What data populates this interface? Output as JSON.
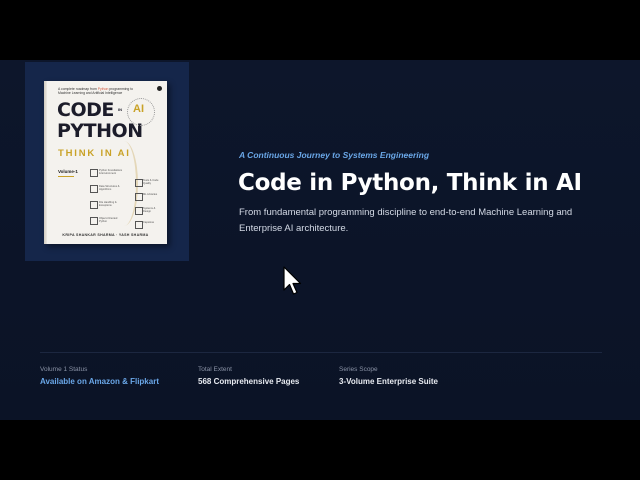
{
  "book_cover": {
    "tagline_prefix": "A complete roadmap from",
    "tagline_highlight": "Python",
    "tagline_rest": "programming to Machine Learning and Artificial Intelligence",
    "title_line1": "CODE",
    "title_in": "IN",
    "title_line2": "PYTHON",
    "ai_badge": "AI",
    "subtitle": "THINK IN AI",
    "volume": "Volume-1",
    "authors": "KRIPA SHANKAR SHARMA · YASH SHARMA",
    "icon_labels": [
      "Python Foundations & Environment",
      "Data Structures & Algorithms",
      "File Handling & Exceptions",
      "Object-Oriented Python",
      "Tests & Code Quality",
      "ML Libraries",
      "Systems & Design",
      "Capstone"
    ]
  },
  "hero": {
    "kicker": "A Continuous Journey to Systems Engineering",
    "title": "Code in Python, Think in AI",
    "description": "From fundamental programming discipline to end-to-end Machine Learning and Enterprise AI architecture."
  },
  "stats": [
    {
      "label": "Volume 1 Status",
      "value": "Available on Amazon & Flipkart",
      "accent": true
    },
    {
      "label": "Total Extent",
      "value": "568 Comprehensive Pages",
      "accent": false
    },
    {
      "label": "Series Scope",
      "value": "3-Volume Enterprise Suite",
      "accent": false
    }
  ],
  "colors": {
    "background": "#0c1428",
    "cover_panel": "#15264a",
    "accent_blue": "#6aa7e8",
    "gold": "#c9a227"
  }
}
